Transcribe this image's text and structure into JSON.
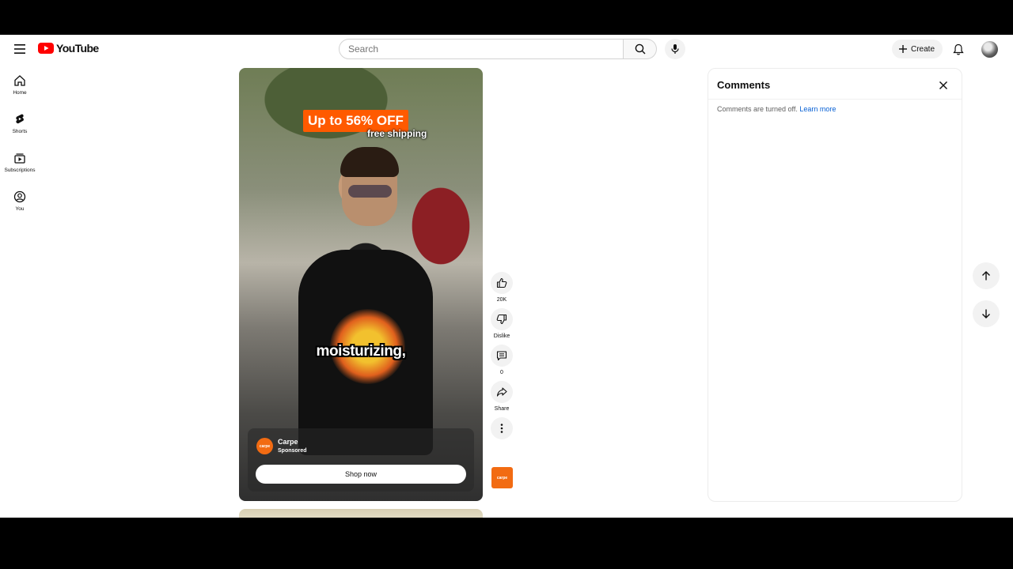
{
  "header": {
    "logo_text": "YouTube",
    "search_placeholder": "Search",
    "create_label": "Create"
  },
  "sidebar": {
    "items": [
      {
        "label": "Home",
        "icon": "home-icon"
      },
      {
        "label": "Shorts",
        "icon": "shorts-icon"
      },
      {
        "label": "Subscriptions",
        "icon": "subscriptions-icon"
      },
      {
        "label": "You",
        "icon": "you-icon"
      }
    ]
  },
  "video": {
    "promo_title": "Up to 56% OFF",
    "promo_subtitle": "free shipping",
    "caption": "moisturizing,",
    "ad": {
      "brand_logo_text": "carpe",
      "advertiser": "Carpe",
      "sponsored_label": "Sponsored",
      "cta_label": "Shop now"
    }
  },
  "actions": {
    "like_count": "20K",
    "dislike_label": "Dislike",
    "comment_count": "0",
    "share_label": "Share",
    "brand_tile_text": "carpe"
  },
  "comments": {
    "title": "Comments",
    "off_message": "Comments are turned off.",
    "learn_more": "Learn more"
  },
  "colors": {
    "youtube_red": "#ff0000",
    "promo_orange": "#ff5a00",
    "brand_orange": "#f26b12",
    "link_blue": "#065fd4"
  }
}
